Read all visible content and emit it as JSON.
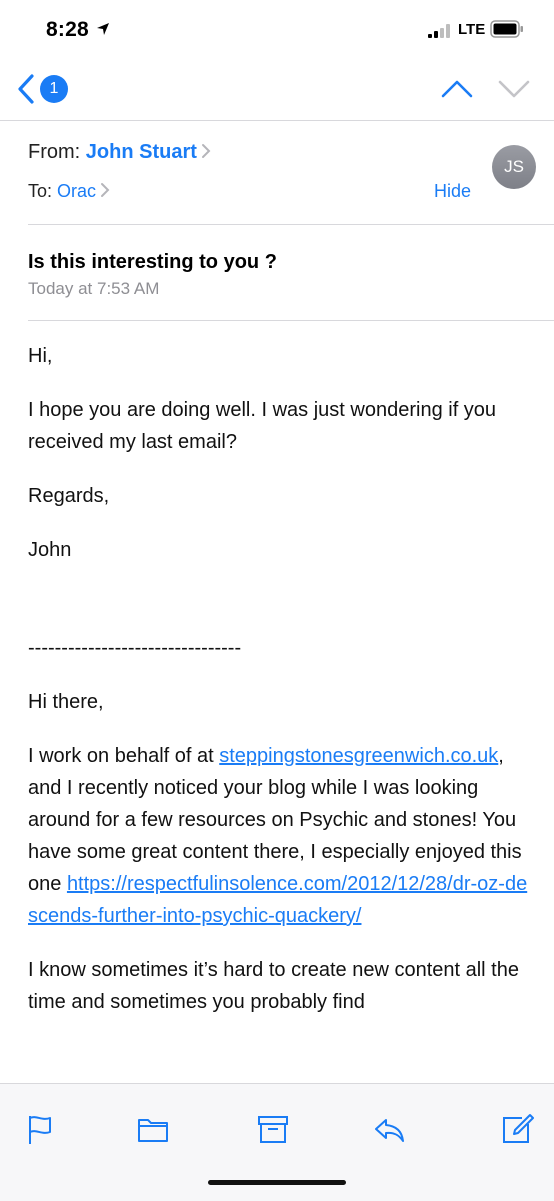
{
  "status": {
    "time": "8:28",
    "network": "LTE"
  },
  "nav": {
    "unread_count": "1"
  },
  "header": {
    "from_label": "From:",
    "from_name": "John Stuart",
    "to_label": "To:",
    "to_name": "Orac",
    "hide_label": "Hide",
    "avatar_initials": "JS",
    "subject": "Is this interesting to you ?",
    "date": "Today at 7:53 AM"
  },
  "body": {
    "greeting": "Hi,",
    "line1": "I hope you are doing well. I was just wondering if you received my last email?",
    "regards": "Regards,",
    "signature": "John",
    "separator": "--------------------------------",
    "greeting2": "Hi there,",
    "p_pre": "I work on behalf of at ",
    "p_link1": "steppingstonesgreenwich.co.uk",
    "p_mid": ", and I recently noticed your blog while I was looking around for a few resources on Psychic and stones! You have some great content there, I especially enjoyed this one ",
    "p_link2": "https://respectfulinsolence.com/2012/12/28/dr-oz-descends-further-into-psychic-quackery/",
    "last": "I know sometimes it’s hard to create new content all the time and sometimes you probably find"
  },
  "toolbar": {
    "icons": [
      "flag-icon",
      "folder-icon",
      "archive-icon",
      "reply-icon",
      "compose-icon"
    ]
  },
  "colors": {
    "accent": "#1a7cf5",
    "secondary_text": "#8e8e93"
  }
}
